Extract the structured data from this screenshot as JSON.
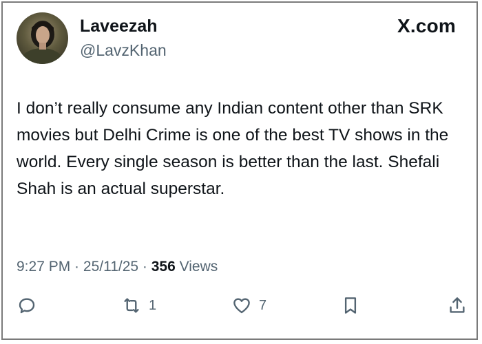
{
  "brand": "X.com",
  "user": {
    "name": "Laveezah",
    "handle": "@LavzKhan"
  },
  "tweet": {
    "text": "I don’t really consume any Indian content other than SRK movies but Delhi Crime is one of the best TV shows in the world. Every single season is better than the last. Shefali Shah is an actual superstar."
  },
  "meta": {
    "time": "9:27 PM",
    "separator": " · ",
    "date": "25/11/25",
    "views_count": "356",
    "views_label": "Views"
  },
  "actions": {
    "reply_icon": "comment-icon",
    "retweet_icon": "retweet-icon",
    "retweet_count": "1",
    "like_icon": "heart-icon",
    "like_count": "7",
    "bookmark_icon": "bookmark-icon",
    "share_icon": "share-icon"
  },
  "colors": {
    "text": "#0f1419",
    "secondary": "#536471",
    "border": "#7a7a7a"
  }
}
